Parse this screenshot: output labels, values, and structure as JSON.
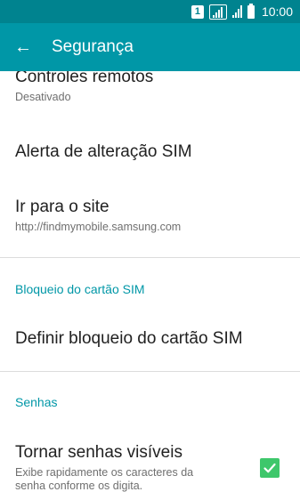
{
  "status_bar": {
    "sim_label": "1",
    "time": "10:00"
  },
  "app_bar": {
    "title": "Segurança"
  },
  "items": {
    "remote_controls": {
      "title": "Controles remotos",
      "subtitle": "Desativado"
    },
    "sim_change_alert": {
      "title": "Alerta de alteração SIM"
    },
    "go_to_site": {
      "title": "Ir para o site",
      "subtitle": "http://findmymobile.samsung.com"
    },
    "sim_lock_header": "Bloqueio do cartão SIM",
    "set_sim_lock": {
      "title": "Definir bloqueio do cartão SIM"
    },
    "passwords_header": "Senhas",
    "visible_passwords": {
      "title": "Tornar senhas visíveis",
      "subtitle_line1": "Exibe rapidamente os caracteres da",
      "subtitle_line2": "senha conforme os digita.",
      "checked": true
    }
  },
  "colors": {
    "status_bar": "#00838f",
    "app_bar": "#0097a7",
    "accent": "#0097a7",
    "checkbox": "#3ec76b"
  }
}
